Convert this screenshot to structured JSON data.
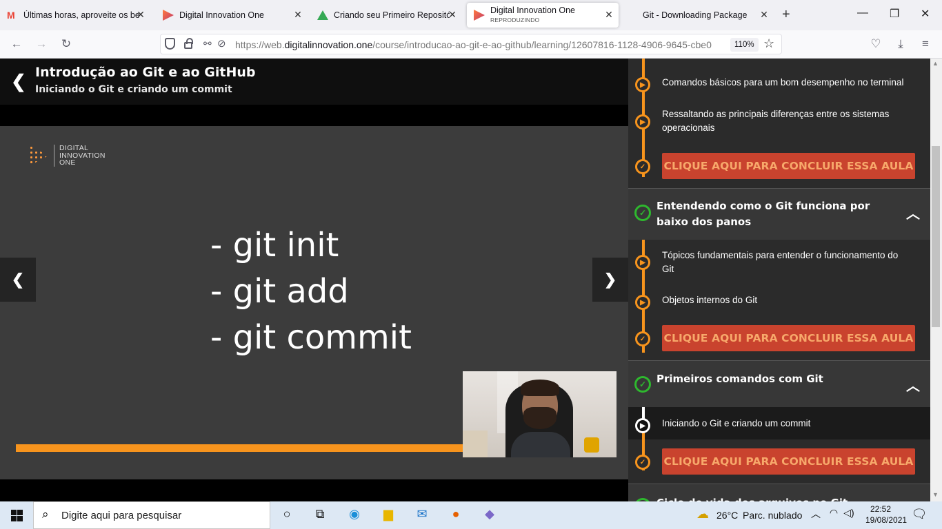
{
  "browser": {
    "tabs": [
      {
        "title": "Últimas horas, aproveite os bene",
        "icon": "gmail-icon",
        "active": false
      },
      {
        "title": "Digital Innovation One",
        "icon": "dio-icon",
        "active": false
      },
      {
        "title": "Criando seu Primeiro Repositório",
        "icon": "google-drive-icon",
        "active": false
      },
      {
        "title": "Digital Innovation One",
        "subtitle": "REPRODUZINDO",
        "icon": "dio-icon",
        "active": true
      },
      {
        "title": "Git - Downloading Package",
        "icon": "git-icon",
        "active": false
      }
    ],
    "close_glyph": "✕",
    "new_tab_glyph": "+",
    "window_controls": {
      "minimize": "—",
      "maximize": "❐",
      "close": "✕"
    },
    "url_prefix": "https://web.",
    "url_domain": "digitalinnovation.one",
    "url_path": "/course/introducao-ao-git-e-ao-github/learning/12607816-1128-4906-9645-cbe0",
    "zoom": "110%"
  },
  "course": {
    "title": "Introdução ao Git e ao GitHub",
    "lesson": "Iniciando o Git e criando um commit"
  },
  "player": {
    "logo_lines": [
      "DIGITAL",
      "INNOVATION",
      "ONE"
    ],
    "code_lines": [
      "- git init",
      "- git add",
      "- git commit"
    ],
    "progress_percent": 74
  },
  "sidebar": {
    "conclude_label": "CLIQUE AQUI PARA CONCLUIR ESSA AULA",
    "lessons_top": [
      "Comandos básicos para um bom desempenho no terminal",
      "Ressaltando as principais diferenças entre os sistemas operacionais"
    ],
    "sections": [
      {
        "title": "Entendendo como o Git funciona por baixo dos panos",
        "completed": true,
        "lessons": [
          "Tópicos fundamentais para entender o funcionamento do Git",
          "Objetos internos do Git"
        ]
      },
      {
        "title": "Primeiros comandos com Git",
        "completed": true,
        "lessons": [
          "Iniciando o Git e criando um commit"
        ]
      },
      {
        "title": "Ciclo de vida dos arquivos no Git",
        "completed": true,
        "lessons": []
      }
    ]
  },
  "taskbar": {
    "search_placeholder": "Digite aqui para pesquisar",
    "weather_temp": "26°C",
    "weather_desc": "Parc. nublado",
    "time": "22:52",
    "date": "19/08/2021"
  },
  "colors": {
    "accent_orange": "#f7941d",
    "button_red": "#c9432e",
    "check_green": "#2eb82e"
  }
}
